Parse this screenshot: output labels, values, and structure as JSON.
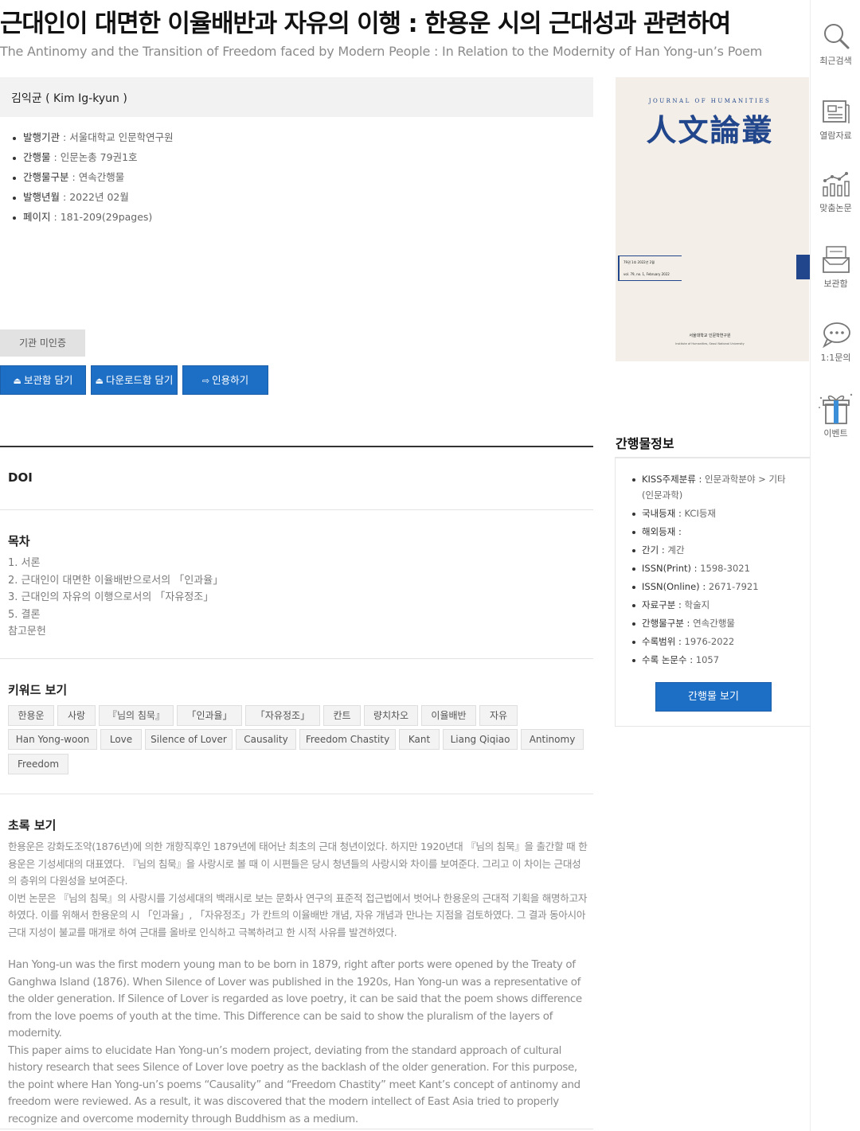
{
  "article": {
    "title_ko": "근대인이 대면한 이율배반과 자유의 이행 : 한용운 시의 근대성과 관련하여",
    "title_en": "The Antinomy and the Transition of Freedom faced by Modern People : In Relation to the Modernity of Han Yong-un’s Poem",
    "author": "김익균 ( Kim Ig-kyun )",
    "meta": [
      {
        "key": "발행기관",
        "value": "서울대학교 인문학연구원"
      },
      {
        "key": "간행물",
        "value": "인문논총 79권1호"
      },
      {
        "key": "간행물구분",
        "value": "연속간행물"
      },
      {
        "key": "발행년월",
        "value": "2022년 02월"
      },
      {
        "key": "페이지",
        "value": "181-209(29pages)"
      }
    ],
    "sep": " : "
  },
  "actions": {
    "auth_badge": "기관 미인증",
    "save_label": "보관함 담기",
    "download_label": "다운로드함 담기",
    "cite_label": "인용하기"
  },
  "doi": {
    "heading": "DOI"
  },
  "toc": {
    "heading": "목차",
    "items": [
      "1. 서론",
      "2. 근대인이 대면한 이율배반으로서의 「인과율」",
      "3. 근대인의 자유의 이행으로서의 「자유정조」",
      "5. 결론",
      "참고문헌"
    ]
  },
  "keywords": {
    "heading": "키워드 보기",
    "items": [
      "한용운",
      "사랑",
      "『님의 침묵』",
      "「인과율」",
      "「자유정조」",
      "칸트",
      "량치차오",
      "이율배반",
      "자유",
      "Han Yong-woon",
      "Love",
      "Silence of Lover",
      "Causality",
      "Freedom Chastity",
      "Kant",
      "Liang Qiqiao",
      "Antinomy",
      "Freedom"
    ]
  },
  "abstract": {
    "heading": "초록 보기",
    "ko": [
      "한용운은 강화도조약(1876년)에 의한 개항직후인 1879년에 태어난 최초의 근대 청년이었다. 하지만 1920년대 『님의 침묵』을 출간할 때 한용운은 기성세대의 대표였다. 『님의 침묵』을 사랑시로 볼 때 이 시편들은 당시 청년들의 사랑시와 차이를 보여준다. 그리고 이 차이는 근대성의 층위의 다원성을 보여준다.",
      "이번 논문은 『님의 침묵』의 사랑시를 기성세대의 백래시로 보는 문화사 연구의 표준적 접근법에서 벗어나 한용운의 근대적 기획을 해명하고자 하였다. 이를 위해서 한용운의 시 「인과율」, 「자유정조」가 칸트의 이율배반 개념, 자유 개념과 만나는 지점을 검토하였다. 그 결과 동아시아 근대 지성이 불교를 매개로 하여 근대를 올바로 인식하고 극복하려고 한 시적 사유를 발견하였다."
    ],
    "en": [
      "Han Yong-un was the first modern young man to be born in 1879, right after ports were opened by the Treaty of Ganghwa Island (1876). When Silence of Lover was published in the 1920s, Han Yong-un was a representative of the older generation. If Silence of Lover is regarded as love poetry, it can be said that the poem shows difference from the love poems of youth at the time. This Difference can be said to show the pluralism of the layers of modernity.",
      "This paper aims to elucidate Han Yong-un’s modern project, deviating from the standard approach of cultural history research that sees Silence of Lover love poetry as the backlash of the older generation. For this purpose, the point where Han Yong-un’s poems “Causality” and “Freedom Chastity” meet Kant’s concept of antinomy and freedom were reviewed. As a result, it was discovered that the modern intellect of East Asia tried to properly recognize and overcome modernity through Buddhism as a medium."
    ]
  },
  "cover": {
    "journal_en": "JOURNAL OF HUMANITIES",
    "journal_hanja": "人文論叢",
    "issue_ko": "79권 1호 2022년 2월",
    "issue_en": "vol. 79, no. 1, February 2022",
    "publisher_ko": "서울대학교 인문학연구원",
    "publisher_en": "Institute of Humanities, Seoul National University",
    "spine_color": "#21468c"
  },
  "pub_info": {
    "heading": "간행물정보",
    "items": [
      {
        "key": "KISS주제분류",
        "value": "인문과학분야 > 기타(인문과학)"
      },
      {
        "key": "국내등재",
        "value": "KCI등재"
      },
      {
        "key": "해외등재",
        "value": ""
      },
      {
        "key": "간기",
        "value": "계간"
      },
      {
        "key": "ISSN(Print)",
        "value": "1598-3021"
      },
      {
        "key": "ISSN(Online)",
        "value": "2671-7921"
      },
      {
        "key": "자료구분",
        "value": "학술지"
      },
      {
        "key": "간행물구분",
        "value": "연속간행물"
      },
      {
        "key": "수록범위",
        "value": "1976-2022"
      },
      {
        "key": "수록 논문수",
        "value": "1057"
      }
    ],
    "view_button": "간행물 보기"
  },
  "sidebar": {
    "items": [
      {
        "label": "최근검색",
        "icon": "search-icon"
      },
      {
        "label": "열람자료",
        "icon": "document-icon"
      },
      {
        "label": "맞춤논문",
        "icon": "chart-icon"
      },
      {
        "label": "보관함",
        "icon": "inbox-icon"
      },
      {
        "label": "1:1문의",
        "icon": "chat-icon"
      },
      {
        "label": "이벤트",
        "icon": "gift-icon"
      }
    ]
  },
  "colors": {
    "accent": "#1d6fc6",
    "cover_bg": "#f3efe8",
    "cover_title": "#21468c"
  }
}
